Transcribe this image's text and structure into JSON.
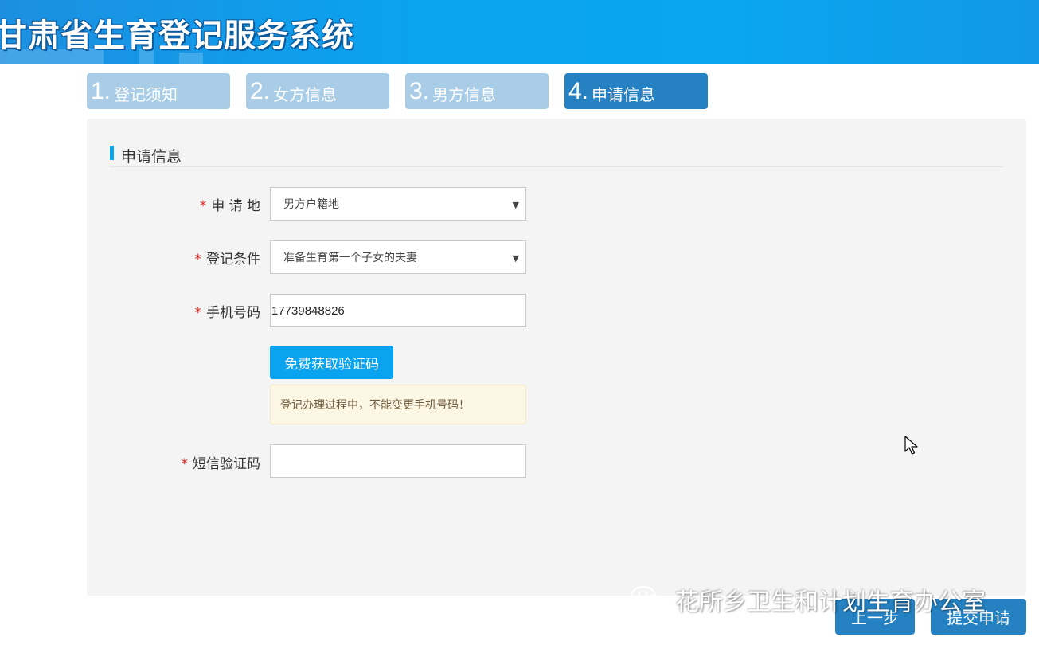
{
  "header": {
    "title": "甘肃省生育登记服务系统"
  },
  "steps": [
    {
      "num": "1.",
      "label": "登记须知"
    },
    {
      "num": "2.",
      "label": "女方信息"
    },
    {
      "num": "3.",
      "label": "男方信息"
    },
    {
      "num": "4.",
      "label": "申请信息"
    }
  ],
  "active_step": 4,
  "section": {
    "title": "申请信息"
  },
  "form": {
    "required_mark": "*",
    "apply_place": {
      "label": "申 请 地",
      "value": "男方户籍地"
    },
    "condition": {
      "label": "登记条件",
      "value": "准备生育第一个子女的夫妻"
    },
    "phone": {
      "label": "手机号码",
      "value": "17739848826"
    },
    "get_code_button": "免费获取验证码",
    "warning": "登记办理过程中，不能变更手机号码！",
    "sms_code": {
      "label": "短信验证码",
      "value": ""
    }
  },
  "buttons": {
    "prev": "上一步",
    "submit": "提交申请"
  },
  "watermark": {
    "text": "花所乡卫生和计划生育办公室"
  },
  "colors": {
    "accent": "#0aa3ef",
    "step_active": "#2581c1",
    "step_inactive": "#a9cde6",
    "required": "#e0241f"
  }
}
